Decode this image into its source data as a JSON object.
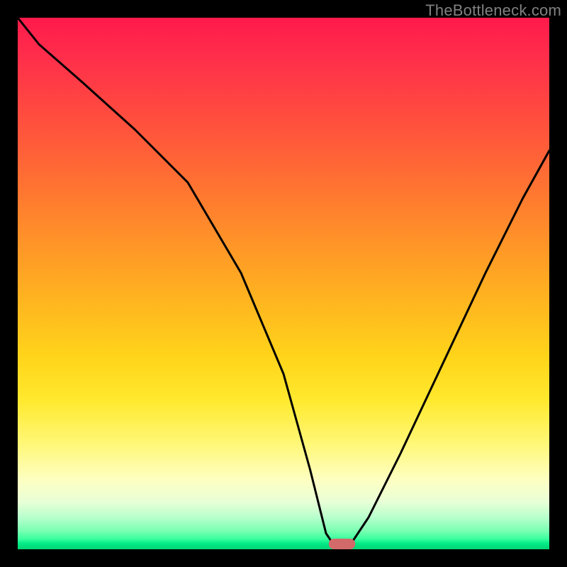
{
  "watermark": "TheBottleneck.com",
  "chart_data": {
    "type": "line",
    "title": "",
    "xlabel": "",
    "ylabel": "",
    "xlim": [
      0,
      100
    ],
    "ylim": [
      0,
      100
    ],
    "grid": false,
    "legend": false,
    "background_gradient": {
      "direction": "vertical",
      "stops": [
        {
          "pos": 0,
          "color": "#ff1a4b"
        },
        {
          "pos": 30,
          "color": "#ff6e33"
        },
        {
          "pos": 64,
          "color": "#ffd51a"
        },
        {
          "pos": 87,
          "color": "#fdffc2"
        },
        {
          "pos": 100,
          "color": "#00d373"
        }
      ]
    },
    "series": [
      {
        "name": "bottleneck-curve",
        "x": [
          0,
          4,
          12,
          22,
          32,
          42,
          50,
          55,
          58,
          60,
          62,
          66,
          72,
          80,
          88,
          95,
          100
        ],
        "y": [
          100,
          95,
          88,
          79,
          69,
          52,
          33,
          15,
          3,
          0,
          0,
          6,
          18,
          35,
          52,
          66,
          75
        ]
      }
    ],
    "marker": {
      "name": "optimal-marker",
      "x_center": 61,
      "y": 0,
      "width": 5,
      "height": 2,
      "color": "#d26a6a"
    }
  }
}
